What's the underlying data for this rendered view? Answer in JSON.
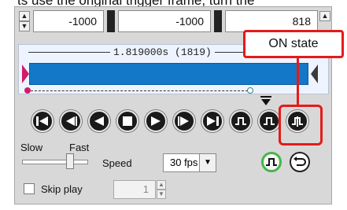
{
  "caption": "ts use the original trigger frame, turn the",
  "top_fields": {
    "value1": "-1000",
    "value2": "-1000",
    "value3": "818"
  },
  "timeline": {
    "duration_label": "1.819000s (1819)"
  },
  "transport": [
    {
      "name": "skip-to-start"
    },
    {
      "name": "step-back"
    },
    {
      "name": "play-reverse"
    },
    {
      "name": "stop"
    },
    {
      "name": "play"
    },
    {
      "name": "step-forward"
    },
    {
      "name": "skip-to-end"
    },
    {
      "name": "trigger-off"
    },
    {
      "name": "trigger-on"
    }
  ],
  "speed": {
    "slow_label": "Slow",
    "fast_label": "Fast",
    "speed_label": "Speed",
    "fps_value": "30 fps"
  },
  "skip_play": {
    "label": "Skip play",
    "value": "1",
    "checked": false
  },
  "annotation": {
    "callout_text": "ON state",
    "color": "#e31b1b"
  }
}
